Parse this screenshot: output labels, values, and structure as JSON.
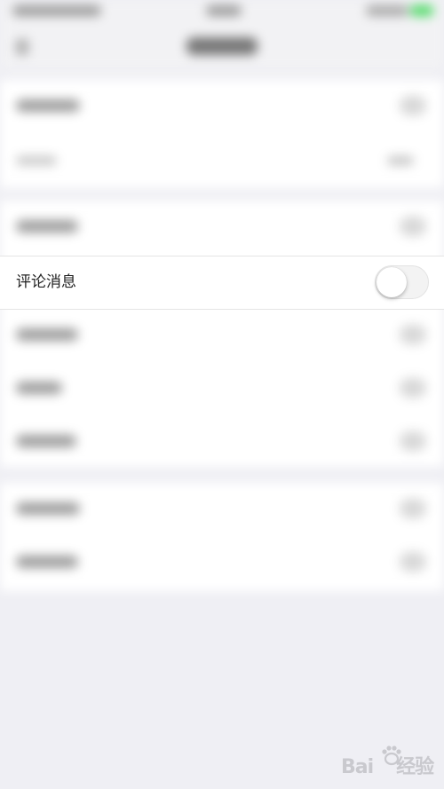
{
  "comment_row": {
    "label": "评论消息",
    "toggle_on": false
  },
  "watermark": {
    "text_prefix": "Bai",
    "text_suffix": "经验"
  }
}
